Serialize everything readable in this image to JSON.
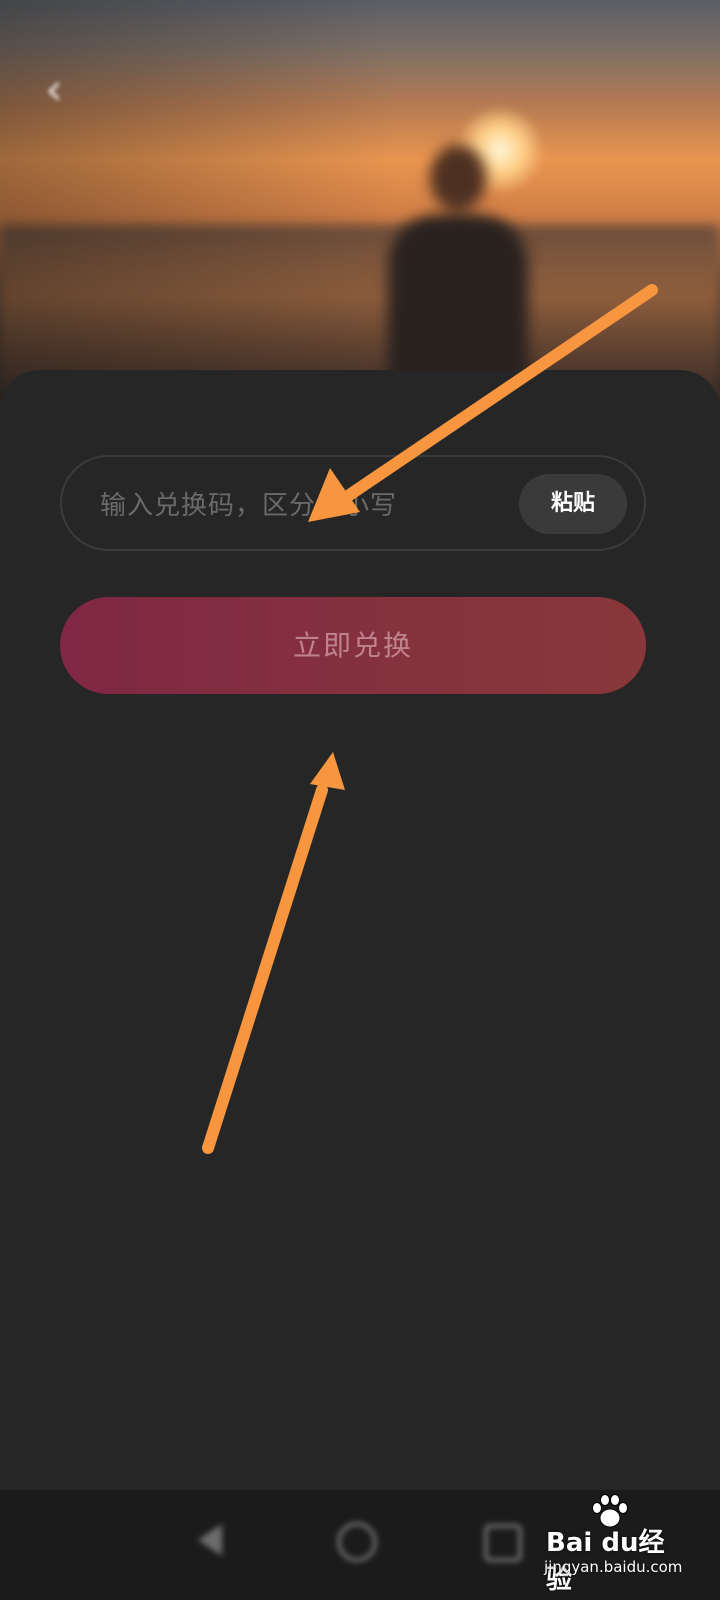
{
  "status_bar": {
    "left_text": "",
    "right_text": ""
  },
  "header": {
    "title": ""
  },
  "hero": {
    "vip_title": "",
    "vip_subtitle": ""
  },
  "redeem_form": {
    "code_value": "",
    "code_placeholder": "输入兑换码，区分大小写",
    "paste_label": "粘贴",
    "submit_label": "立即兑换"
  },
  "rules": {
    "blurred": true,
    "lines": [
      "",
      "",
      "",
      "",
      "",
      "",
      "",
      ""
    ]
  },
  "watermark": {
    "brand": "Bai du经验",
    "url": "jingyan.baidu.com"
  },
  "annotations": {
    "arrow_color": "#f7963f",
    "arrow_count": 2
  },
  "colors": {
    "background": "#262626",
    "button_gradient_start": "#7f2744",
    "button_gradient_end": "#89373a",
    "paste_button": "#3a3a3a"
  },
  "icons": {
    "back": "back-arrow-icon",
    "nav_back": "triangle-back-icon",
    "nav_home": "circle-home-icon",
    "nav_recent": "square-recent-icon",
    "watermark": "baidu-paw-icon"
  }
}
